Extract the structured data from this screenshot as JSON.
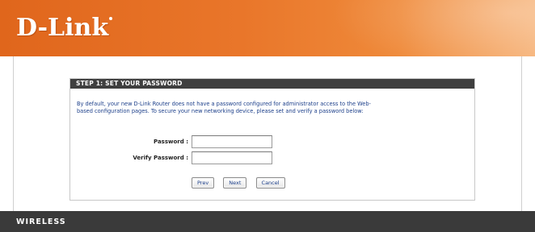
{
  "header": {
    "logo_text": "D-Link",
    "colors": {
      "banner_start": "#e0661c",
      "banner_end": "#f6b277"
    }
  },
  "panel": {
    "title": "STEP 1: SET YOUR PASSWORD",
    "description_line1": "By default, your new D-Link Router does not have a password configured for administrator access to the Web-",
    "description_line2": "based configuration pages. To secure your new networking device, please set and verify a password below:"
  },
  "form": {
    "password_label": "Password :",
    "password_value": "",
    "verify_label": "Verify Password :",
    "verify_value": ""
  },
  "buttons": {
    "prev": "Prev",
    "next": "Next",
    "cancel": "Cancel"
  },
  "footer": {
    "brand": "WIRELESS"
  }
}
